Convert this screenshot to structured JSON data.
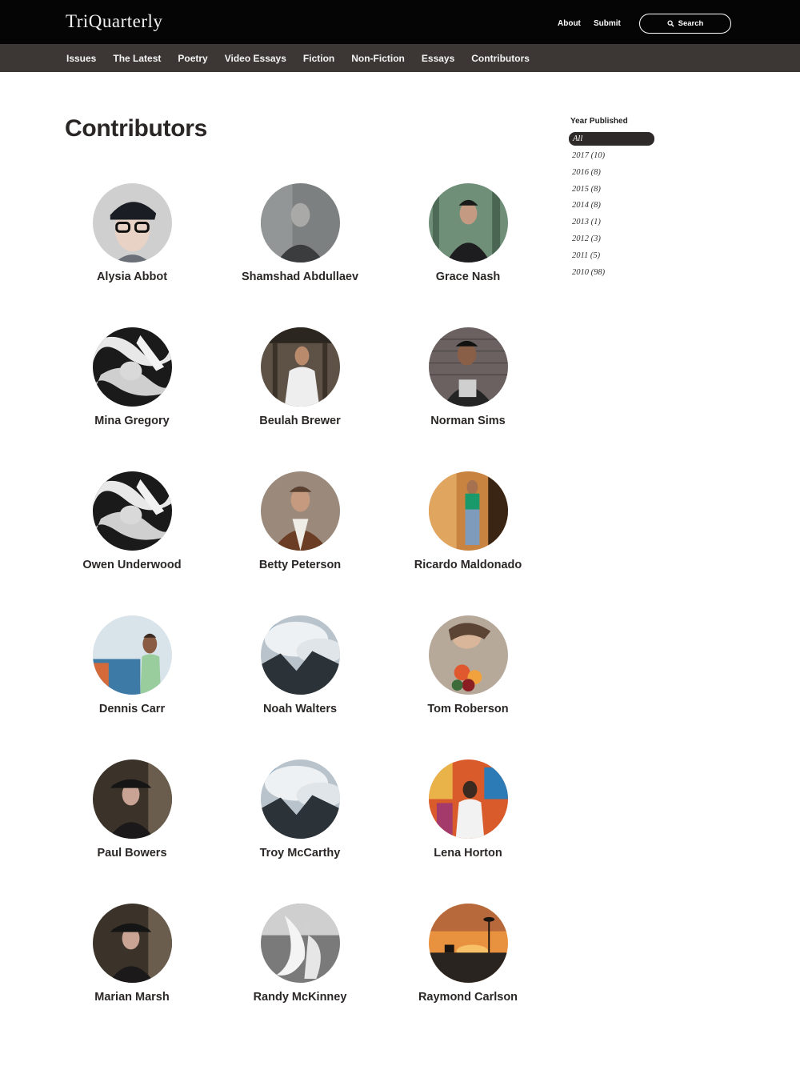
{
  "header": {
    "logo": "TriQuarterly",
    "links": {
      "about": "About",
      "submit": "Submit"
    },
    "search_label": "Search"
  },
  "nav": {
    "items": [
      "Issues",
      "The Latest",
      "Poetry",
      "Video Essays",
      "Fiction",
      "Non-Fiction",
      "Essays",
      "Contributors"
    ]
  },
  "page": {
    "title": "Contributors"
  },
  "sidebar": {
    "title": "Year Published",
    "items": [
      "All",
      "2017 (10)",
      "2016 (8)",
      "2015 (8)",
      "2014 (8)",
      "2013 (1)",
      "2012 (3)",
      "2011 (5)",
      "2010 (98)"
    ],
    "active_index": 0
  },
  "contributors": [
    {
      "name": "Alysia Abbot",
      "photo": "woman-glasses-cap"
    },
    {
      "name": "Shamshad Abdullaev",
      "photo": "man-grayscale"
    },
    {
      "name": "Grace Nash",
      "photo": "man-forest"
    },
    {
      "name": "Mina Gregory",
      "photo": "bw-pattern"
    },
    {
      "name": "Beulah Brewer",
      "photo": "man-white-tee"
    },
    {
      "name": "Norman Sims",
      "photo": "man-brick-wall"
    },
    {
      "name": "Owen Underwood",
      "photo": "bw-pattern"
    },
    {
      "name": "Betty Peterson",
      "photo": "man-brown-shirt"
    },
    {
      "name": "Ricardo Maldonado",
      "photo": "woman-green-top"
    },
    {
      "name": "Dennis Carr",
      "photo": "man-colorful-street"
    },
    {
      "name": "Noah Walters",
      "photo": "mountain-clouds"
    },
    {
      "name": "Tom Roberson",
      "photo": "woman-flowers"
    },
    {
      "name": "Paul Bowers",
      "photo": "woman-dark-hat"
    },
    {
      "name": "Troy McCarthy",
      "photo": "mountain-clouds"
    },
    {
      "name": "Lena Horton",
      "photo": "man-colorful-wall"
    },
    {
      "name": "Marian Marsh",
      "photo": "woman-dark-hat"
    },
    {
      "name": "Randy McKinney",
      "photo": "bw-dancer"
    },
    {
      "name": "Raymond Carlson",
      "photo": "sunset-street"
    }
  ],
  "colors": {
    "topbar": "#050505",
    "navbar": "#3c3735",
    "active_filter": "#2e2a29",
    "text": "#2b2726"
  }
}
